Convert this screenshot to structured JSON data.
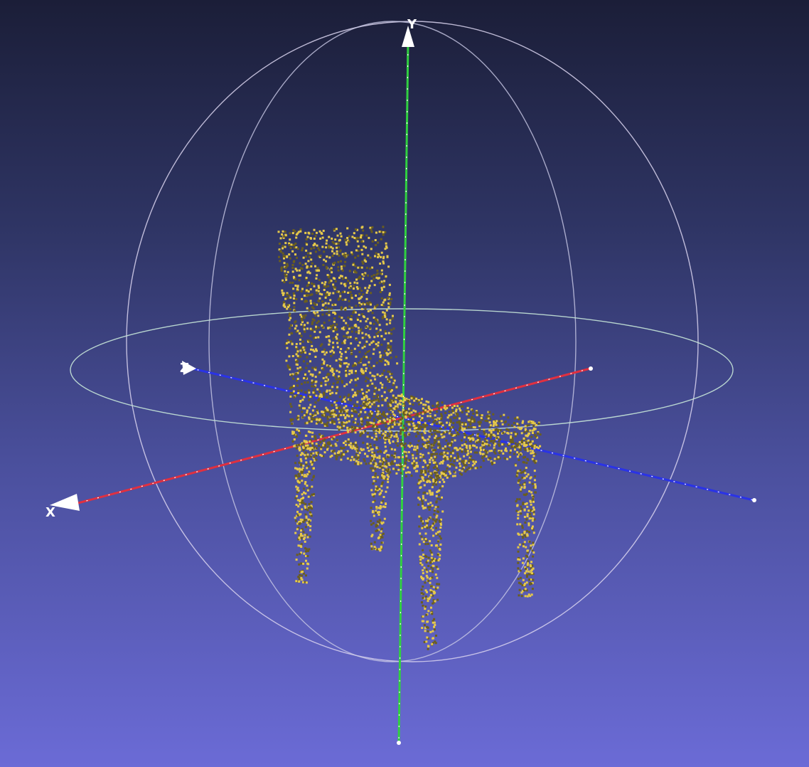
{
  "viewer": {
    "axes": {
      "x": {
        "label": "X",
        "color": "#e0303a"
      },
      "y": {
        "label": "Y",
        "color": "#2ec93a"
      },
      "z": {
        "label": "Z",
        "color": "#2832e8"
      }
    },
    "trackball": {
      "colors": [
        "#dfe3f5",
        "#cfe8dc",
        "#ead2e4"
      ]
    },
    "background": {
      "top": "#1b1e38",
      "bottom": "#6b6bd6"
    }
  },
  "point_cloud": {
    "object": "chair",
    "point_color": "#e6c94a",
    "shadow_color": "#6b5e1e"
  }
}
